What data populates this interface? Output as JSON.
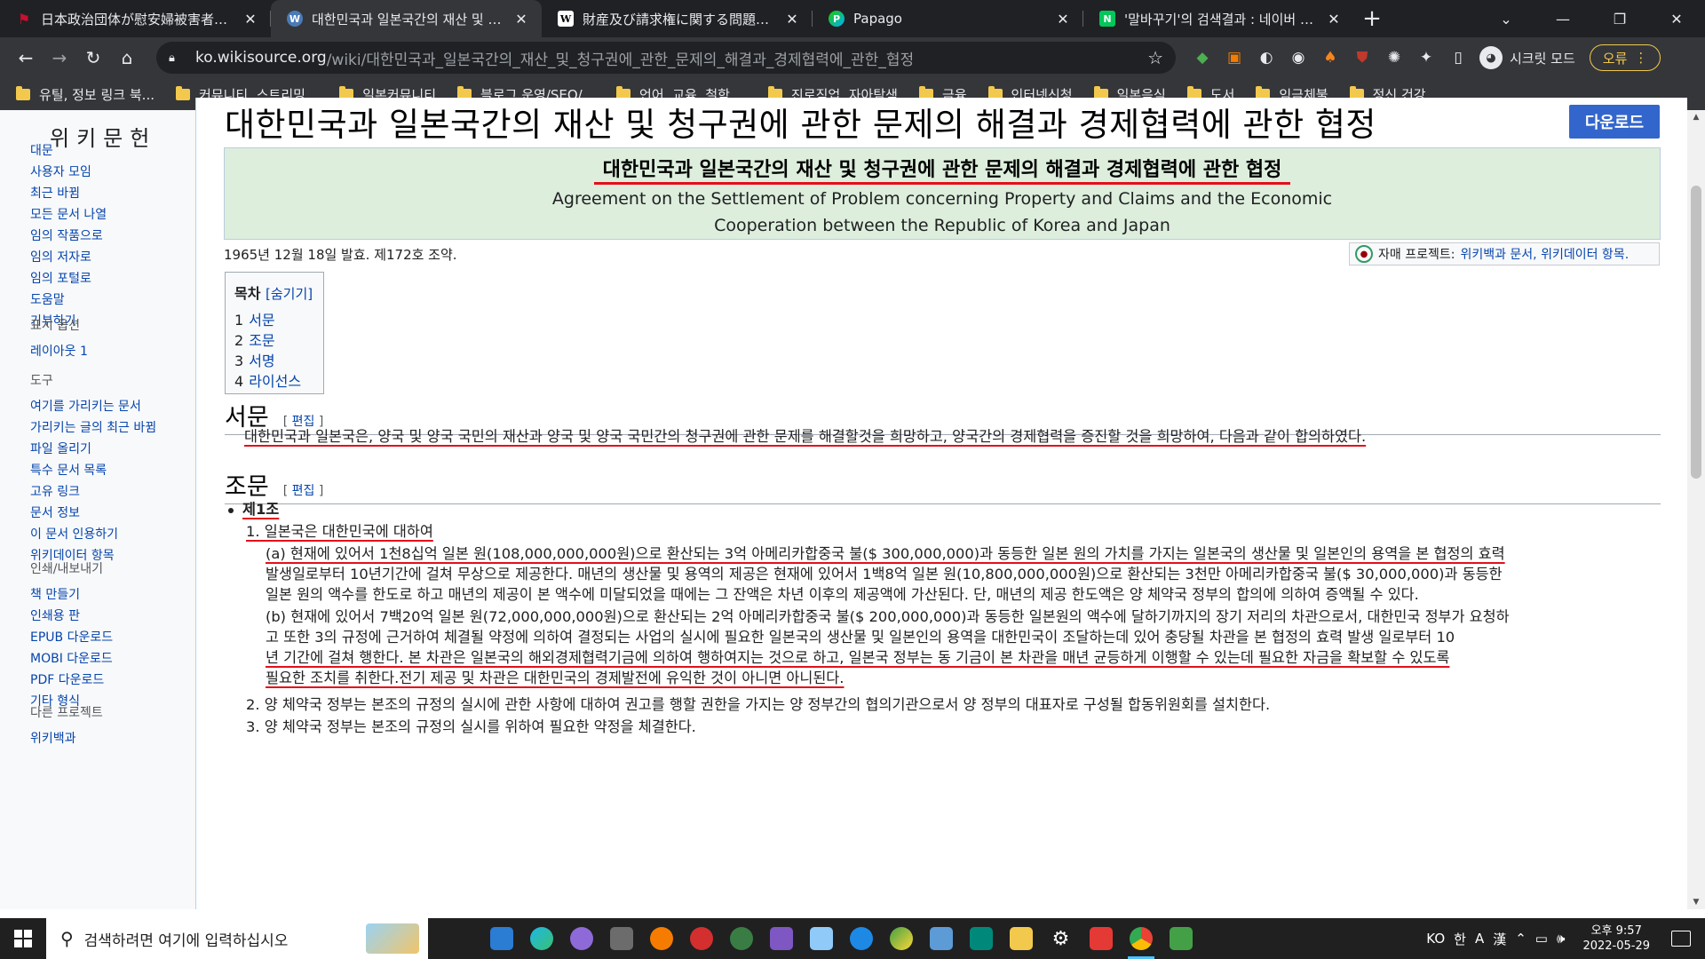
{
  "tabs": [
    {
      "title": "日本政治団体が慰安婦被害者を朝…",
      "favicon": "red-flag-icon",
      "color": "#c8102e",
      "active": false
    },
    {
      "title": "대한민국과 일본국간의 재산 및 청구",
      "favicon": "wikisource-icon",
      "color": "#4a7bb7",
      "active": true
    },
    {
      "title": "財産及び請求権に関する問題の解決",
      "favicon": "wikipedia-icon",
      "color": "#ffffff",
      "active": false
    },
    {
      "title": "Papago",
      "favicon": "papago-icon",
      "color": "#1ec800",
      "active": false
    },
    {
      "title": "'말바꾸기'의 검색결과 : 네이버 사전",
      "favicon": "naver-icon",
      "color": "#03c75a",
      "active": false
    }
  ],
  "address": {
    "host": "ko.wikisource.org",
    "path": "/wiki/대한민국과_일본국간의_재산_및_청구권에_관한_문제의_해결과_경제협력에_관한_협정"
  },
  "incognito_label": "시크릿 모드",
  "error_label": "오류",
  "bookmarks": [
    "유틸, 정보 링크 북...",
    "커뮤니티, 스트리밍...",
    "일본커뮤니티",
    "블로그 운영/SEO/...",
    "언어, 교육, 철학,...",
    "진로직업, 자아탐색",
    "금융",
    "인터넷신청",
    "일본음식",
    "도서",
    "임금체불",
    "정신,건강"
  ],
  "sidebar": {
    "logo": "위키문헌",
    "nav": [
      "대문",
      "사용자 모임",
      "최근 바뀜",
      "모든 문서 나열",
      "임의 작품으로",
      "임의 저자로",
      "임의 포털로",
      "도움말",
      "기부하기"
    ],
    "display_head": "표시 옵션",
    "display": [
      "레이아웃 1"
    ],
    "tools_head": "도구",
    "tools": [
      "여기를 가리키는 문서",
      "가리키는 글의 최근 바뀜",
      "파일 올리기",
      "특수 문서 목록",
      "고유 링크",
      "문서 정보",
      "이 문서 인용하기",
      "위키데이터 항목"
    ],
    "print_head": "인쇄/내보내기",
    "print": [
      "책 만들기",
      "인쇄용 판",
      "EPUB 다운로드",
      "MOBI 다운로드",
      "PDF 다운로드",
      "기타 형식"
    ],
    "other_head": "다른 프로젝트",
    "other": [
      "위키백과"
    ]
  },
  "page": {
    "title": "대한민국과 일본국간의 재산 및 청구권에 관한 문제의 해결과 경제협력에 관한 협정",
    "download_label": "다운로드",
    "header_ko": "대한민국과 일본국간의 재산 및 청구권에 관한 문제의 해결과 경제협력에 관한 협정",
    "header_en_1": "Agreement on the Settlement of Problem concerning Property and Claims and the Economic",
    "header_en_2": "Cooperation between the Republic of Korea and Japan",
    "meta": "1965년 12월 18일 발효. 제172호 조약.",
    "sister_prefix": "자매 프로젝트:",
    "sister_links": "위키백과 문서, 위키데이터 항목.",
    "toc_title": "목차",
    "toc_toggle": "[숨기기]",
    "toc": [
      {
        "num": "1",
        "label": "서문"
      },
      {
        "num": "2",
        "label": "조문"
      },
      {
        "num": "3",
        "label": "서명"
      },
      {
        "num": "4",
        "label": "라이선스"
      }
    ],
    "sec1_title": "서문",
    "edit_label": "편집",
    "preamble": "대한민국과 일본국은, 양국 및 양국 국민의 재산과 양국 및 양국 국민간의 청구권에 관한 문제를 해결할것을 희망하고, 양국간의 경제협력을 증진할 것을 희망하여, 다음과 같이 합의하였다.",
    "sec2_title": "조문",
    "article1": "제1조",
    "a1_1": "1. 일본국은 대한민국에 대하여",
    "a1_a_l1": "(a) 현재에 있어서 1천8십억 일본 원(108,000,000,000원)으로 환산되는 3억 아메리카합중국 불($ 300,000,000)과 동등한 일본 원의 가치를 가지는 일본국의 생산물 및 일본인의 용역을 본 협정의 효력",
    "a1_a_l2": "발생일로부터 10년기간에 걸쳐 무상으로 제공한다. 매년의 생산물 및 용역의 제공은 현재에 있어서 1백8억 일본 원(10,800,000,000원)으로 환산되는 3천만 아메리카합중국 불($ 30,000,000)과 동등한",
    "a1_a_l3": "일본 원의 액수를 한도로 하고 매년의 제공이 본 액수에 미달되었을 때에는 그 잔액은 차년 이후의 제공액에 가산된다. 단, 매년의 제공 한도액은 양 체약국 정부의 합의에 의하여 증액될 수 있다.",
    "a1_b_l1": "(b) 현재에 있어서 7백20억 일본 원(72,000,000,000원)으로 환산되는 2억 아메리카합중국 불($ 200,000,000)과 동등한 일본원의 액수에 달하기까지의 장기 저리의 차관으로서, 대한민국 정부가 요청하",
    "a1_b_l2": "고 또한 3의 규정에 근거하여 체결될 약정에 의하여 결정되는 사업의 실시에 필요한 일본국의 생산물 및 일본인의 용역을 대한민국이 조달하는데 있어 충당될 차관을 본 협정의 효력 발생 일로부터 10",
    "a1_b_l3": "년 기간에 걸쳐 행한다. 본 차관은 일본국의 해외경제협력기금에 의하여 행하여지는 것으로 하고, 일본국 정부는 동 기금이 본 차관을 매년 균등하게 이행할 수 있는데 필요한 자금을 확보할 수 있도록",
    "a1_b_l4": "필요한 조치를 취한다.전기 제공 및 차관은 대한민국의 경제발전에 유익한 것이 아니면 아니된다.",
    "a1_2": "2. 양 체약국 정부는 본조의 규정의 실시에 관한 사항에 대하여 권고를 행할 권한을 가지는 양 정부간의 협의기관으로서 양 정부의 대표자로 구성될 합동위원회를 설치한다.",
    "a1_3": "3. 양 체약국 정부는 본조의 규정의 실시를 위하여 필요한 약정을 체결한다."
  },
  "taskbar": {
    "search_placeholder": "검색하려면 여기에 입력하십시오",
    "ime": "KO",
    "ime2": "한",
    "ime3": "A",
    "ime4": "漢",
    "time": "오후 9:57",
    "date": "2022-05-29"
  },
  "colors": {
    "accent_red": "#e3101a",
    "link": "#0645ad",
    "download_btn": "#3366cc",
    "header_bg": "#ddeedd"
  }
}
